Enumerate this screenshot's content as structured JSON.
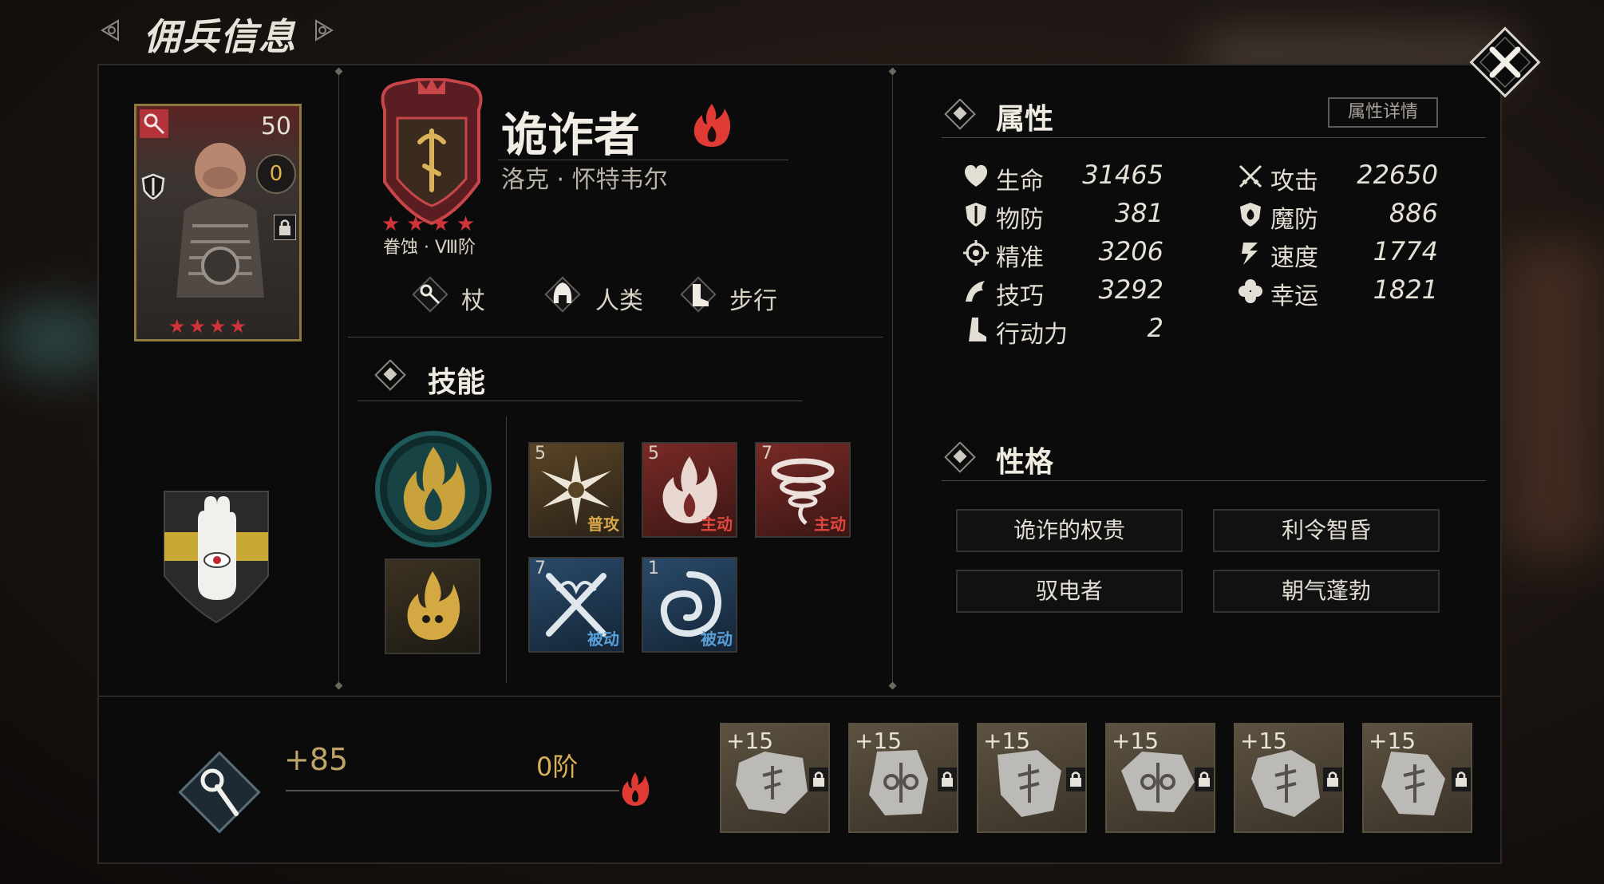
{
  "header": {
    "title": "佣兵信息"
  },
  "character": {
    "level": "50",
    "badge": "0",
    "name": "诡诈者",
    "subname": "洛克 · 怀特韦尔",
    "rank": "眷蚀 · Ⅷ阶",
    "stars": "★★★★",
    "tags": [
      "杖",
      "人类",
      "步行"
    ]
  },
  "skills": {
    "title": "技能",
    "items": [
      {
        "num": "5",
        "type": "普攻",
        "type_color": "#d8a84a"
      },
      {
        "num": "5",
        "type": "主动",
        "type_color": "#e0473f"
      },
      {
        "num": "7",
        "type": "主动",
        "type_color": "#e0473f"
      },
      {
        "num": "7",
        "type": "被动",
        "type_color": "#5a9fd6"
      },
      {
        "num": "1",
        "type": "被动",
        "type_color": "#5a9fd6"
      }
    ]
  },
  "attributes": {
    "title": "属性",
    "detail_button": "属性详情",
    "left": [
      {
        "label": "生命",
        "value": "31465",
        "icon": "heart-icon"
      },
      {
        "label": "物防",
        "value": "381",
        "icon": "shield-sword-icon"
      },
      {
        "label": "精准",
        "value": "3206",
        "icon": "crosshair-icon"
      },
      {
        "label": "技巧",
        "value": "3292",
        "icon": "skill-swirl-icon"
      },
      {
        "label": "行动力",
        "value": "2",
        "icon": "boot-icon"
      }
    ],
    "right": [
      {
        "label": "攻击",
        "value": "22650",
        "icon": "crossed-swords-icon"
      },
      {
        "label": "魔防",
        "value": "886",
        "icon": "magic-shield-icon"
      },
      {
        "label": "速度",
        "value": "1774",
        "icon": "speed-icon"
      },
      {
        "label": "幸运",
        "value": "1821",
        "icon": "clover-icon"
      }
    ]
  },
  "personality": {
    "title": "性格",
    "traits": [
      "诡诈的权贵",
      "利令智昏",
      "驭电者",
      "朝气蓬勃"
    ]
  },
  "weapon": {
    "bonus": "+85",
    "tier": "0阶"
  },
  "runes": [
    "+15",
    "+15",
    "+15",
    "+15",
    "+15",
    "+15"
  ],
  "colors": {
    "accent_red": "#d0333a",
    "gold": "#d9b05a",
    "panel_bg": "#0c0b0b"
  }
}
